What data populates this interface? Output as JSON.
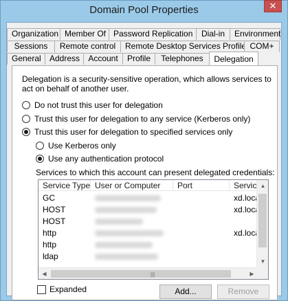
{
  "window": {
    "title": "Domain Pool Properties",
    "close_glyph": "✕"
  },
  "tabs": {
    "row1": [
      "Organization",
      "Member Of",
      "Password Replication",
      "Dial-in",
      "Environment"
    ],
    "row2": [
      "Sessions",
      "Remote control",
      "Remote Desktop Services Profile",
      "COM+"
    ],
    "row3": [
      "General",
      "Address",
      "Account",
      "Profile",
      "Telephones",
      "Delegation"
    ],
    "active": "Delegation"
  },
  "delegation": {
    "description": "Delegation is a security-sensitive operation, which allows services to act on behalf of another user.",
    "options": [
      {
        "label": "Do not trust this user for delegation",
        "selected": false
      },
      {
        "label": "Trust this user for delegation to any service (Kerberos only)",
        "selected": false
      },
      {
        "label": "Trust this user for delegation to specified services only",
        "selected": true
      }
    ],
    "sub_options": [
      {
        "label": "Use Kerberos only",
        "selected": false
      },
      {
        "label": "Use any authentication protocol",
        "selected": true
      }
    ],
    "services_label": "Services to which this account can present delegated credentials:",
    "columns": [
      "Service Type",
      "User or Computer",
      "Port",
      "Service"
    ],
    "rows": [
      {
        "service_type": "GC",
        "service": "xd.loca"
      },
      {
        "service_type": "HOST",
        "service": "xd.loca"
      },
      {
        "service_type": "HOST",
        "service": ""
      },
      {
        "service_type": "http",
        "service": "xd.loca"
      },
      {
        "service_type": "http",
        "service": ""
      },
      {
        "service_type": "ldap",
        "service": ""
      }
    ],
    "expanded_label": "Expanded",
    "expanded_checked": false,
    "add_label": "Add...",
    "remove_label": "Remove"
  },
  "icons": {
    "scroll_up": "▲",
    "scroll_down": "▼",
    "scroll_left": "◀",
    "scroll_right": "▶",
    "grip": "|||"
  }
}
